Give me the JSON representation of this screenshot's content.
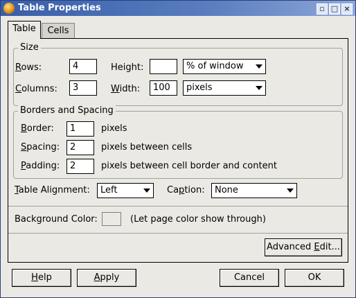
{
  "window": {
    "title": "Table Properties"
  },
  "tabs": [
    {
      "label": "Table"
    },
    {
      "label": "Cells"
    }
  ],
  "size": {
    "title": "Size",
    "rows_label": "Rows:",
    "rows_value": "4",
    "height_label": "Height:",
    "height_value": "",
    "height_unit": "% of window",
    "columns_label": "Columns:",
    "columns_value": "3",
    "width_label": "Width:",
    "width_value": "100",
    "width_unit": "pixels"
  },
  "borders": {
    "title": "Borders and Spacing",
    "border_label": "Border:",
    "border_value": "1",
    "border_unit": "pixels",
    "spacing_label": "Spacing:",
    "spacing_value": "2",
    "spacing_unit": "pixels between cells",
    "padding_label": "Padding:",
    "padding_value": "2",
    "padding_unit": "pixels between cell border and content"
  },
  "alignment": {
    "label": "Table Alignment:",
    "value": "Left"
  },
  "caption": {
    "label": "Caption:",
    "value": "None"
  },
  "background": {
    "label": "Background Color:",
    "note": "(Let page color show through)"
  },
  "buttons": {
    "advanced": "Advanced Edit...",
    "help": "Help",
    "apply": "Apply",
    "cancel": "Cancel",
    "ok": "OK"
  }
}
